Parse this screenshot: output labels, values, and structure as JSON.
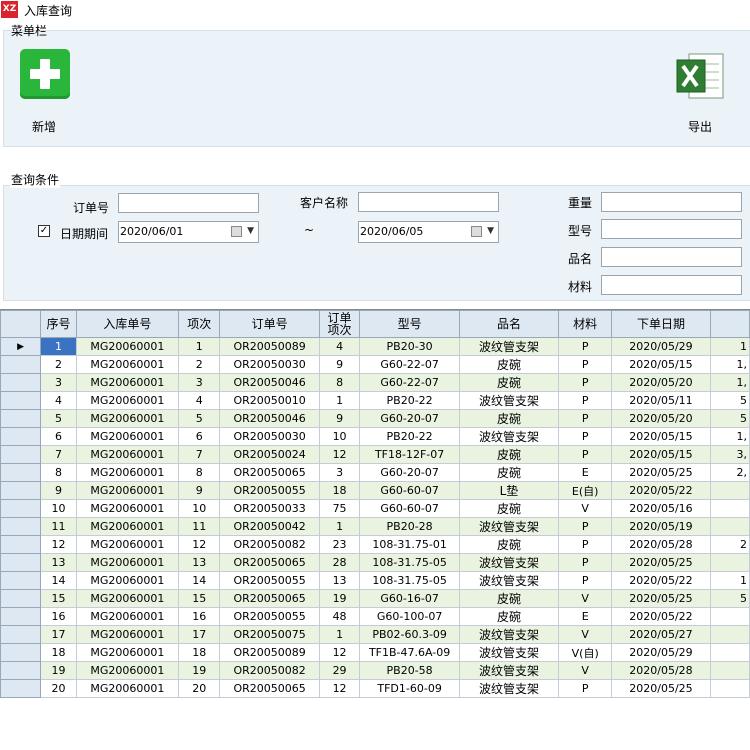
{
  "window": {
    "icon_text": "XZ",
    "title": "入库查询"
  },
  "menu": {
    "legend": "菜单栏",
    "add_label": "新增",
    "export_label": "导出"
  },
  "query": {
    "legend": "查询条件",
    "order_no_label": "订单号",
    "customer_label": "客户名称",
    "weight_label": "重量",
    "model_label": "型号",
    "product_label": "品名",
    "material_label": "材料",
    "date_range_label": "日期期间",
    "date_range_checked": true,
    "date_from": "2020/06/01",
    "date_to": "2020/06/05",
    "tilde": "~"
  },
  "grid": {
    "columns": [
      "序号",
      "入库单号",
      "项次",
      "订单号",
      "订单项次",
      "型号",
      "品名",
      "材料",
      "下单日期"
    ],
    "rows": [
      [
        "1",
        "MG20060001",
        "1",
        "OR20050089",
        "4",
        "PB20-30",
        "波纹管支架",
        "P",
        "2020/05/29",
        "1"
      ],
      [
        "2",
        "MG20060001",
        "2",
        "OR20050030",
        "9",
        "G60-22-07",
        "皮碗",
        "P",
        "2020/05/15",
        "1,"
      ],
      [
        "3",
        "MG20060001",
        "3",
        "OR20050046",
        "8",
        "G60-22-07",
        "皮碗",
        "P",
        "2020/05/20",
        "1,"
      ],
      [
        "4",
        "MG20060001",
        "4",
        "OR20050010",
        "1",
        "PB20-22",
        "波纹管支架",
        "P",
        "2020/05/11",
        "5"
      ],
      [
        "5",
        "MG20060001",
        "5",
        "OR20050046",
        "9",
        "G60-20-07",
        "皮碗",
        "P",
        "2020/05/20",
        "5"
      ],
      [
        "6",
        "MG20060001",
        "6",
        "OR20050030",
        "10",
        "PB20-22",
        "波纹管支架",
        "P",
        "2020/05/15",
        "1,"
      ],
      [
        "7",
        "MG20060001",
        "7",
        "OR20050024",
        "12",
        "TF18-12F-07",
        "皮碗",
        "P",
        "2020/05/15",
        "3,"
      ],
      [
        "8",
        "MG20060001",
        "8",
        "OR20050065",
        "3",
        "G60-20-07",
        "皮碗",
        "E",
        "2020/05/25",
        "2,"
      ],
      [
        "9",
        "MG20060001",
        "9",
        "OR20050055",
        "18",
        "G60-60-07",
        "L垫",
        "E(自)",
        "2020/05/22",
        ""
      ],
      [
        "10",
        "MG20060001",
        "10",
        "OR20050033",
        "75",
        "G60-60-07",
        "皮碗",
        "V",
        "2020/05/16",
        ""
      ],
      [
        "11",
        "MG20060001",
        "11",
        "OR20050042",
        "1",
        "PB20-28",
        "波纹管支架",
        "P",
        "2020/05/19",
        ""
      ],
      [
        "12",
        "MG20060001",
        "12",
        "OR20050082",
        "23",
        "108-31.75-01",
        "皮碗",
        "P",
        "2020/05/28",
        "2"
      ],
      [
        "13",
        "MG20060001",
        "13",
        "OR20050065",
        "28",
        "108-31.75-05",
        "波纹管支架",
        "P",
        "2020/05/25",
        ""
      ],
      [
        "14",
        "MG20060001",
        "14",
        "OR20050055",
        "13",
        "108-31.75-05",
        "波纹管支架",
        "P",
        "2020/05/22",
        "1"
      ],
      [
        "15",
        "MG20060001",
        "15",
        "OR20050065",
        "19",
        "G60-16-07",
        "皮碗",
        "V",
        "2020/05/25",
        "5"
      ],
      [
        "16",
        "MG20060001",
        "16",
        "OR20050055",
        "48",
        "G60-100-07",
        "皮碗",
        "E",
        "2020/05/22",
        ""
      ],
      [
        "17",
        "MG20060001",
        "17",
        "OR20050075",
        "1",
        "PB02-60.3-09",
        "波纹管支架",
        "V",
        "2020/05/27",
        ""
      ],
      [
        "18",
        "MG20060001",
        "18",
        "OR20050089",
        "12",
        "TF1B-47.6A-09",
        "波纹管支架",
        "V(自)",
        "2020/05/29",
        ""
      ],
      [
        "19",
        "MG20060001",
        "19",
        "OR20050082",
        "29",
        "PB20-58",
        "波纹管支架",
        "V",
        "2020/05/28",
        ""
      ],
      [
        "20",
        "MG20060001",
        "20",
        "OR20050065",
        "12",
        "TFD1-60-09",
        "波纹管支架",
        "P",
        "2020/05/25",
        ""
      ]
    ]
  }
}
